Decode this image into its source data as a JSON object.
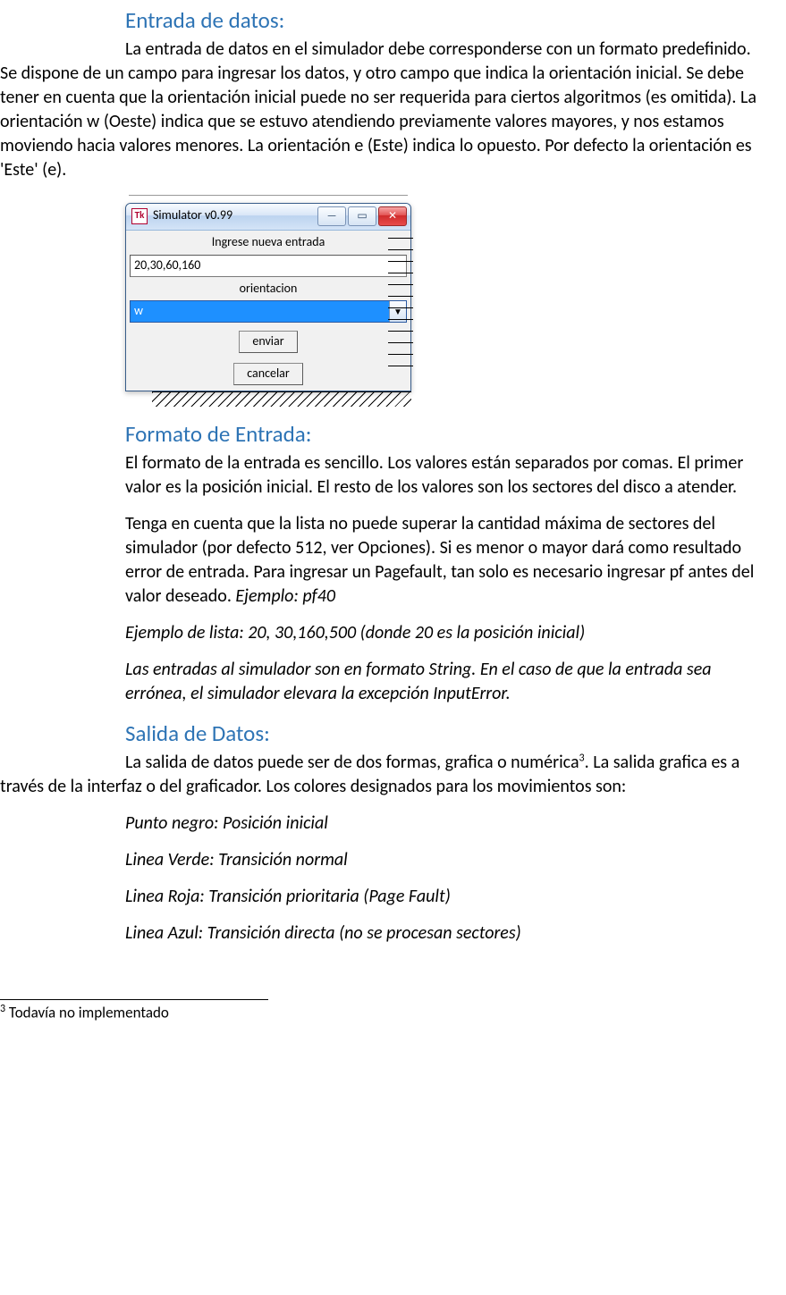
{
  "sections": {
    "entrada": {
      "title": "Entrada de datos:",
      "p1": "La entrada de datos en el simulador debe corresponderse con un formato predefinido. Se dispone de un campo para ingresar los datos, y otro campo que indica la orientación inicial. Se debe tener en cuenta que la orientación inicial puede no ser requerida para ciertos algoritmos (es omitida). La orientación w (Oeste) indica que se estuvo atendiendo previamente valores mayores, y nos estamos moviendo hacia valores menores. La orientación e (Este) indica lo opuesto. Por defecto la orientación es 'Este' (e)."
    },
    "formato": {
      "title": "Formato de Entrada:",
      "p1": "El formato de la entrada es sencillo. Los valores están separados por comas. El primer valor es la posición inicial. El resto de los valores son los sectores del disco a atender.",
      "p2a": "Tenga en cuenta que la lista no puede superar la cantidad máxima de sectores del simulador (por defecto 512, ver Opciones). Si es menor o mayor dará como resultado error de entrada. Para ingresar un Pagefault, tan solo es necesario ingresar pf antes del valor deseado. ",
      "p2b": "Ejemplo: pf40",
      "p3": "Ejemplo de lista: 20, 30,160,500 (donde 20 es la posición inicial)",
      "p4": "Las entradas al simulador son en formato String. En el caso de que la entrada sea errónea, el simulador elevara la excepción InputError."
    },
    "salida": {
      "title": "Salida de Datos:",
      "p1a": "La salida de datos puede ser de dos formas, grafica o numérica",
      "fnref": "3",
      "p1b": ". La salida grafica es a través de la interfaz o del graficador. Los colores designados para los movimientos son:",
      "items": [
        "Punto negro: Posición inicial",
        "Linea Verde: Transición normal",
        "Linea Roja: Transición prioritaria (Page Fault)",
        "Linea Azul: Transición directa (no se procesan sectores)"
      ]
    }
  },
  "simwin": {
    "app_icon": "Tk",
    "title": "Simulator v0.99",
    "label_input": "Ingrese nueva entrada",
    "input_value": "20,30,60,160",
    "label_orient": "orientacion",
    "orient_value": "w",
    "btn_send": "enviar",
    "btn_cancel": "cancelar"
  },
  "footnote": {
    "num": "3",
    "text": " Todavía no implementado"
  }
}
